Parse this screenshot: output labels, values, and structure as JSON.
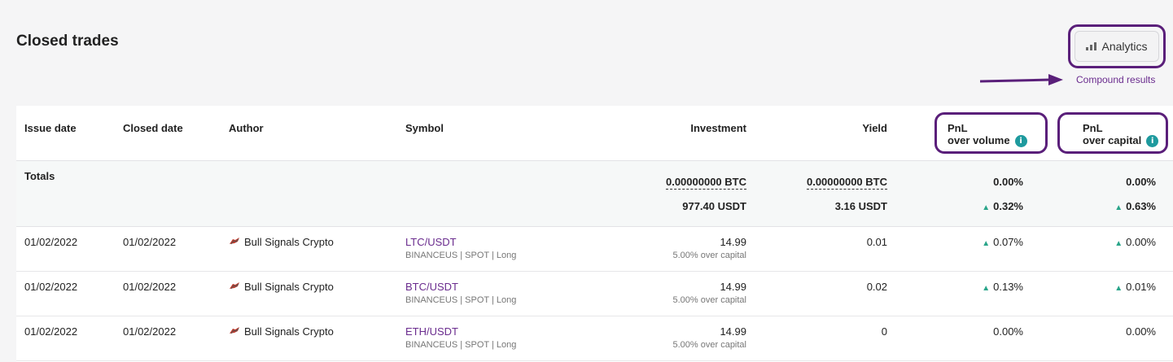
{
  "page": {
    "title": "Closed trades"
  },
  "toolbar": {
    "analytics_label": "Analytics",
    "compound_label": "Compound results"
  },
  "columns": {
    "issue_date": "Issue date",
    "closed_date": "Closed date",
    "author": "Author",
    "symbol": "Symbol",
    "investment": "Investment",
    "yield": "Yield",
    "pnl_volume_line1": "PnL",
    "pnl_volume_line2": "over volume",
    "pnl_capital_line1": "PnL",
    "pnl_capital_line2": "over capital"
  },
  "totals": {
    "label": "Totals",
    "investment_btc": "0.00000000 BTC",
    "investment_usdt": "977.40 USDT",
    "yield_btc": "0.00000000 BTC",
    "yield_usdt": "3.16 USDT",
    "pnl_volume_btc": "0.00%",
    "pnl_volume_usdt": "0.32%",
    "pnl_capital_btc": "0.00%",
    "pnl_capital_usdt": "0.63%"
  },
  "rows": [
    {
      "issue_date": "01/02/2022",
      "closed_date": "01/02/2022",
      "author": "Bull Signals Crypto",
      "symbol": "LTC/USDT",
      "symbol_sub": "BINANCEUS | SPOT | Long",
      "investment": "14.99",
      "investment_sub": "5.00% over capital",
      "yield": "0.01",
      "pnl_volume": "0.07%",
      "pnl_capital": "0.00%"
    },
    {
      "issue_date": "01/02/2022",
      "closed_date": "01/02/2022",
      "author": "Bull Signals Crypto",
      "symbol": "BTC/USDT",
      "symbol_sub": "BINANCEUS | SPOT | Long",
      "investment": "14.99",
      "investment_sub": "5.00% over capital",
      "yield": "0.02",
      "pnl_volume": "0.13%",
      "pnl_capital": "0.01%"
    },
    {
      "issue_date": "01/02/2022",
      "closed_date": "01/02/2022",
      "author": "Bull Signals Crypto",
      "symbol": "ETH/USDT",
      "symbol_sub": "BINANCEUS | SPOT | Long",
      "investment": "14.99",
      "investment_sub": "5.00% over capital",
      "yield": "0",
      "pnl_volume": "0.00%",
      "pnl_capital": "0.00%"
    }
  ],
  "icons": {
    "up": "triangle-up-icon",
    "info": "info-icon",
    "analytics": "bar-chart-icon",
    "author": "bull-avatar-icon"
  },
  "colors": {
    "accent": "#6a2c8e",
    "highlight": "#5a1f7a",
    "positive": "#2aa58a",
    "info": "#1e9a9e"
  }
}
